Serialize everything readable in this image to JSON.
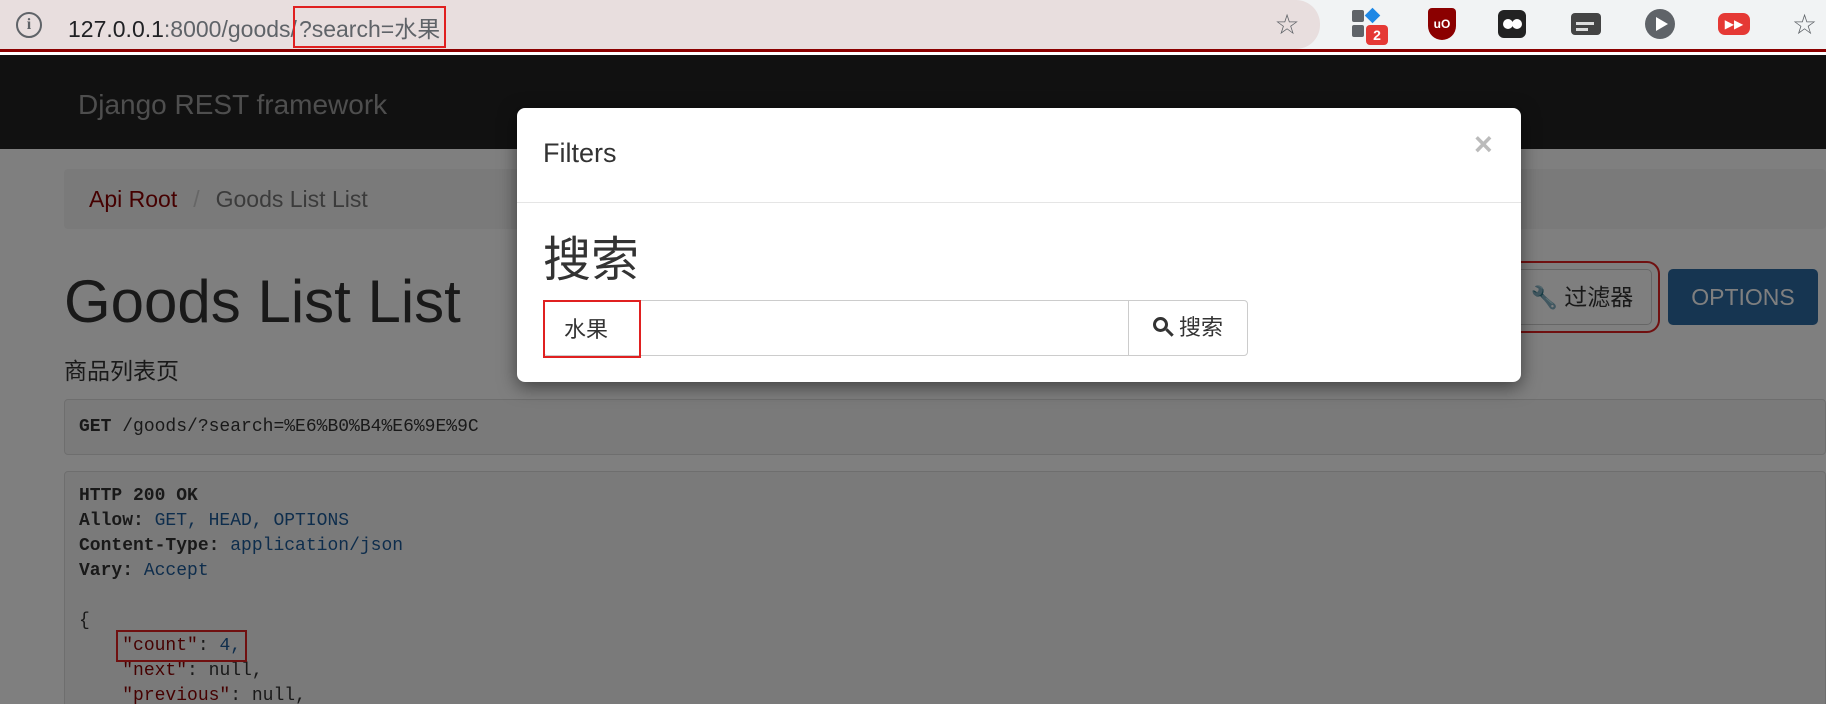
{
  "browser": {
    "url_host": "127.0.0.1",
    "url_port_path": ":8000/goods/",
    "url_query": "?search=水果",
    "ext_badge": "2",
    "ublock_label": "uO",
    "youtube_label": "▶▶"
  },
  "navbar": {
    "brand": "Django REST framework"
  },
  "breadcrumb": {
    "root": "Api Root",
    "separator": "/",
    "current": "Goods List List"
  },
  "page": {
    "title": "Goods List List",
    "description": "商品列表页",
    "filters_button": "过滤器",
    "options_button": "OPTIONS"
  },
  "request": {
    "method": "GET",
    "path": "/goods/?search=%E6%B0%B4%E6%9E%9C"
  },
  "response": {
    "status": "HTTP 200 OK",
    "headers": [
      {
        "name": "Allow:",
        "value": "GET, HEAD, OPTIONS"
      },
      {
        "name": "Content-Type:",
        "value": "application/json"
      },
      {
        "name": "Vary:",
        "value": "Accept"
      }
    ],
    "brace": "{",
    "body": [
      {
        "key": "\"count\"",
        "value": "4,"
      },
      {
        "key": "\"next\"",
        "value": "null,"
      },
      {
        "key": "\"previous\"",
        "value": "null,"
      }
    ]
  },
  "modal": {
    "title": "Filters",
    "close": "×",
    "search_heading": "搜索",
    "search_value": "水果",
    "search_button": "搜索"
  },
  "colors": {
    "highlight": "#e02020",
    "link": "#8b0000",
    "options_button": "#2c6aa3",
    "navbar": "#222222"
  }
}
